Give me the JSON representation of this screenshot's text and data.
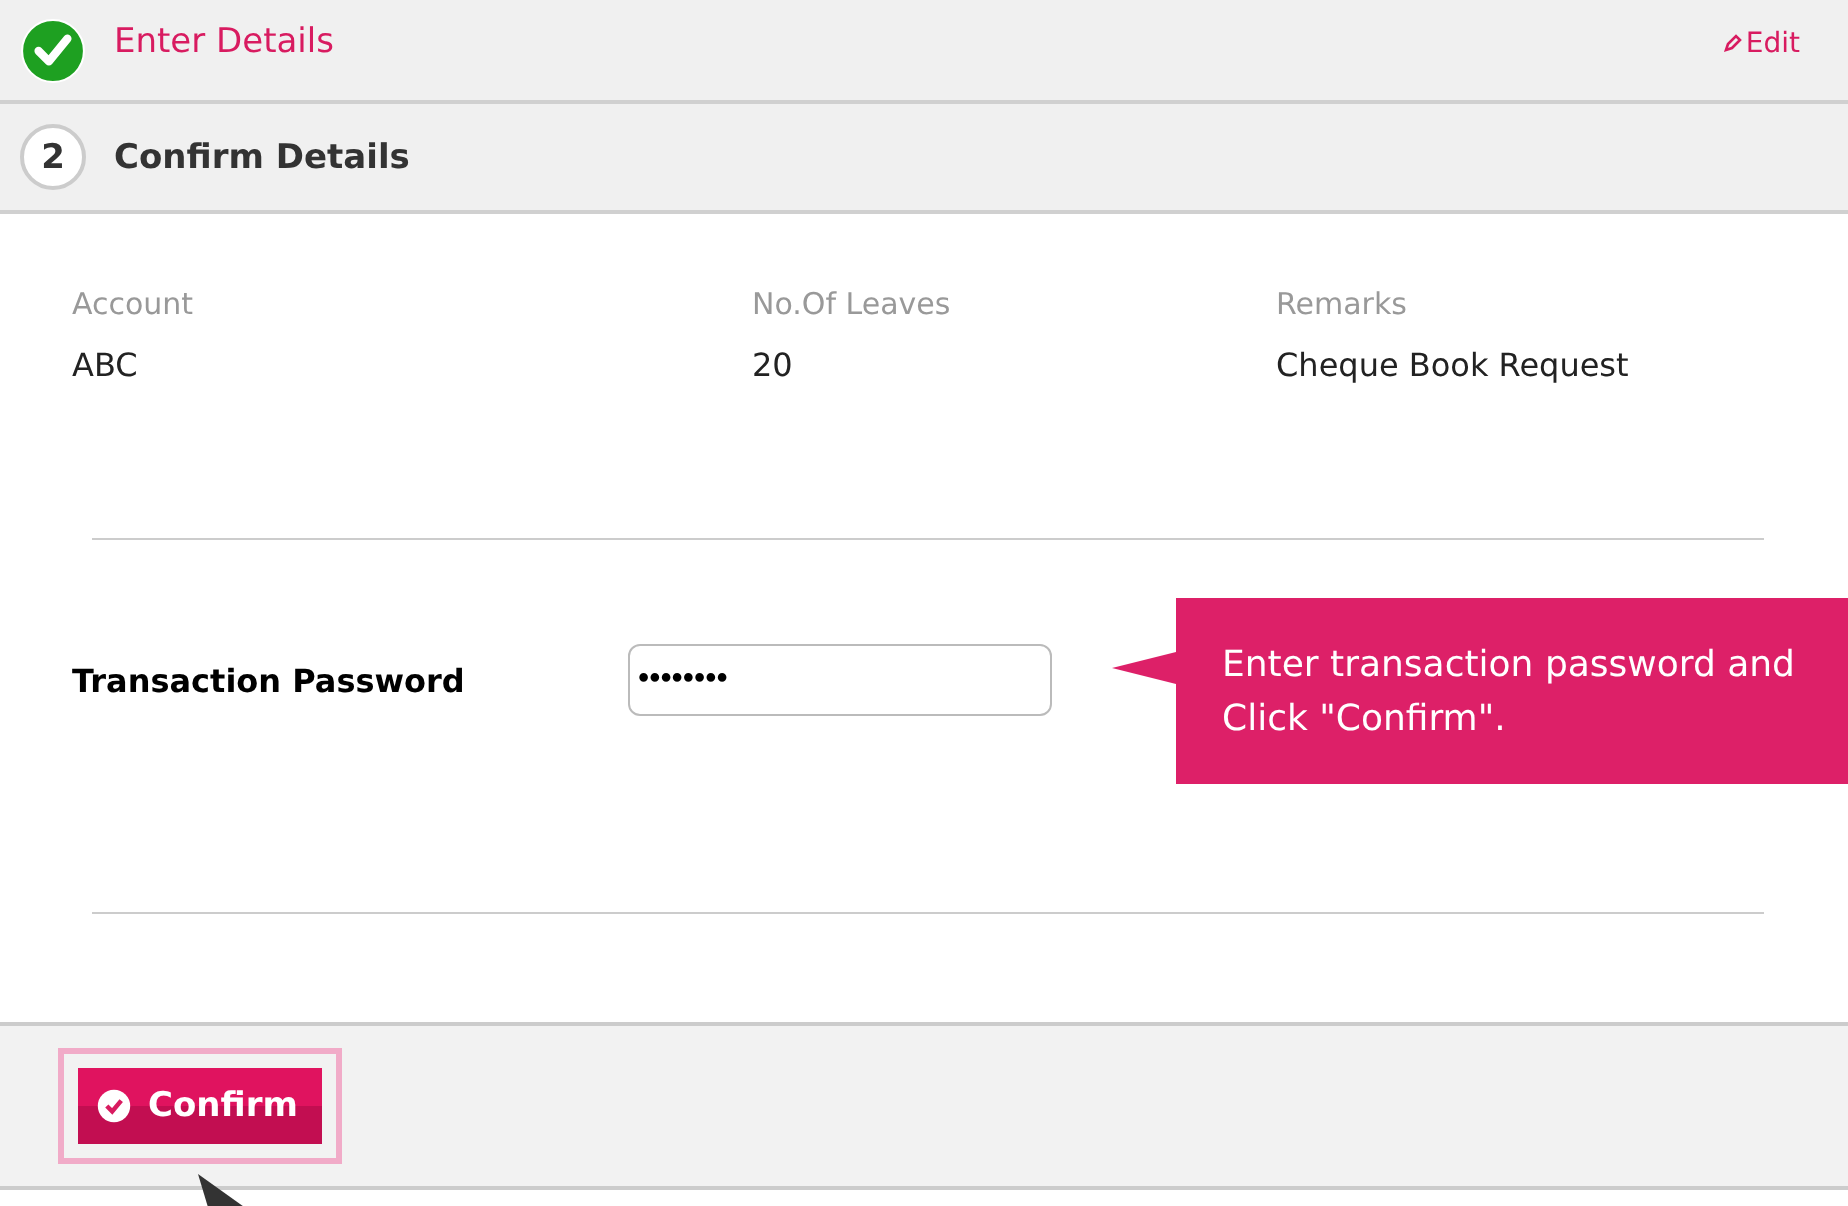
{
  "steps": [
    {
      "kind": "done",
      "title": "Enter Details",
      "action": "Edit"
    },
    {
      "kind": "current",
      "number": "2",
      "title": "Confirm Details"
    }
  ],
  "details": [
    {
      "label": "Account",
      "value": "ABC"
    },
    {
      "label": "No.Of Leaves",
      "value": "20"
    },
    {
      "label": "Remarks",
      "value": "Cheque Book Request"
    }
  ],
  "password": {
    "label": "Transaction Password",
    "value": "••••••••"
  },
  "tooltip": "Enter transaction password and Click \"Confirm\".",
  "confirm_button": "Confirm"
}
